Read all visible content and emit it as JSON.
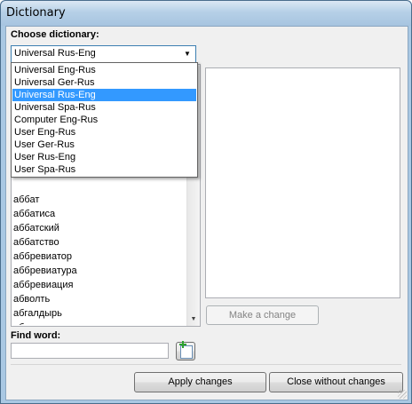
{
  "window": {
    "title": "Dictionary"
  },
  "choose": {
    "label": "Choose dictionary:",
    "selected": "Universal Rus-Eng",
    "options": [
      {
        "label": "Universal Eng-Rus"
      },
      {
        "label": "Universal Ger-Rus"
      },
      {
        "label": "Universal Rus-Eng"
      },
      {
        "label": "Universal Spa-Rus"
      },
      {
        "label": "Computer Eng-Rus"
      },
      {
        "label": "User Eng-Rus"
      },
      {
        "label": "User Ger-Rus"
      },
      {
        "label": "User Rus-Eng"
      },
      {
        "label": "User Spa-Rus"
      }
    ]
  },
  "wordlist": {
    "items": [
      {
        "text": "аббат"
      },
      {
        "text": "аббатиса"
      },
      {
        "text": "аббатский"
      },
      {
        "text": "аббатство"
      },
      {
        "text": "аббревиатор"
      },
      {
        "text": "аббревиатура"
      },
      {
        "text": "аббревиация"
      },
      {
        "text": "абволть"
      },
      {
        "text": "абгалдырь"
      },
      {
        "text": "абгенри"
      }
    ]
  },
  "buttons": {
    "make_change": "Make a change",
    "apply": "Apply changes",
    "close": "Close without changes"
  },
  "find": {
    "label": "Find word:",
    "value": ""
  }
}
